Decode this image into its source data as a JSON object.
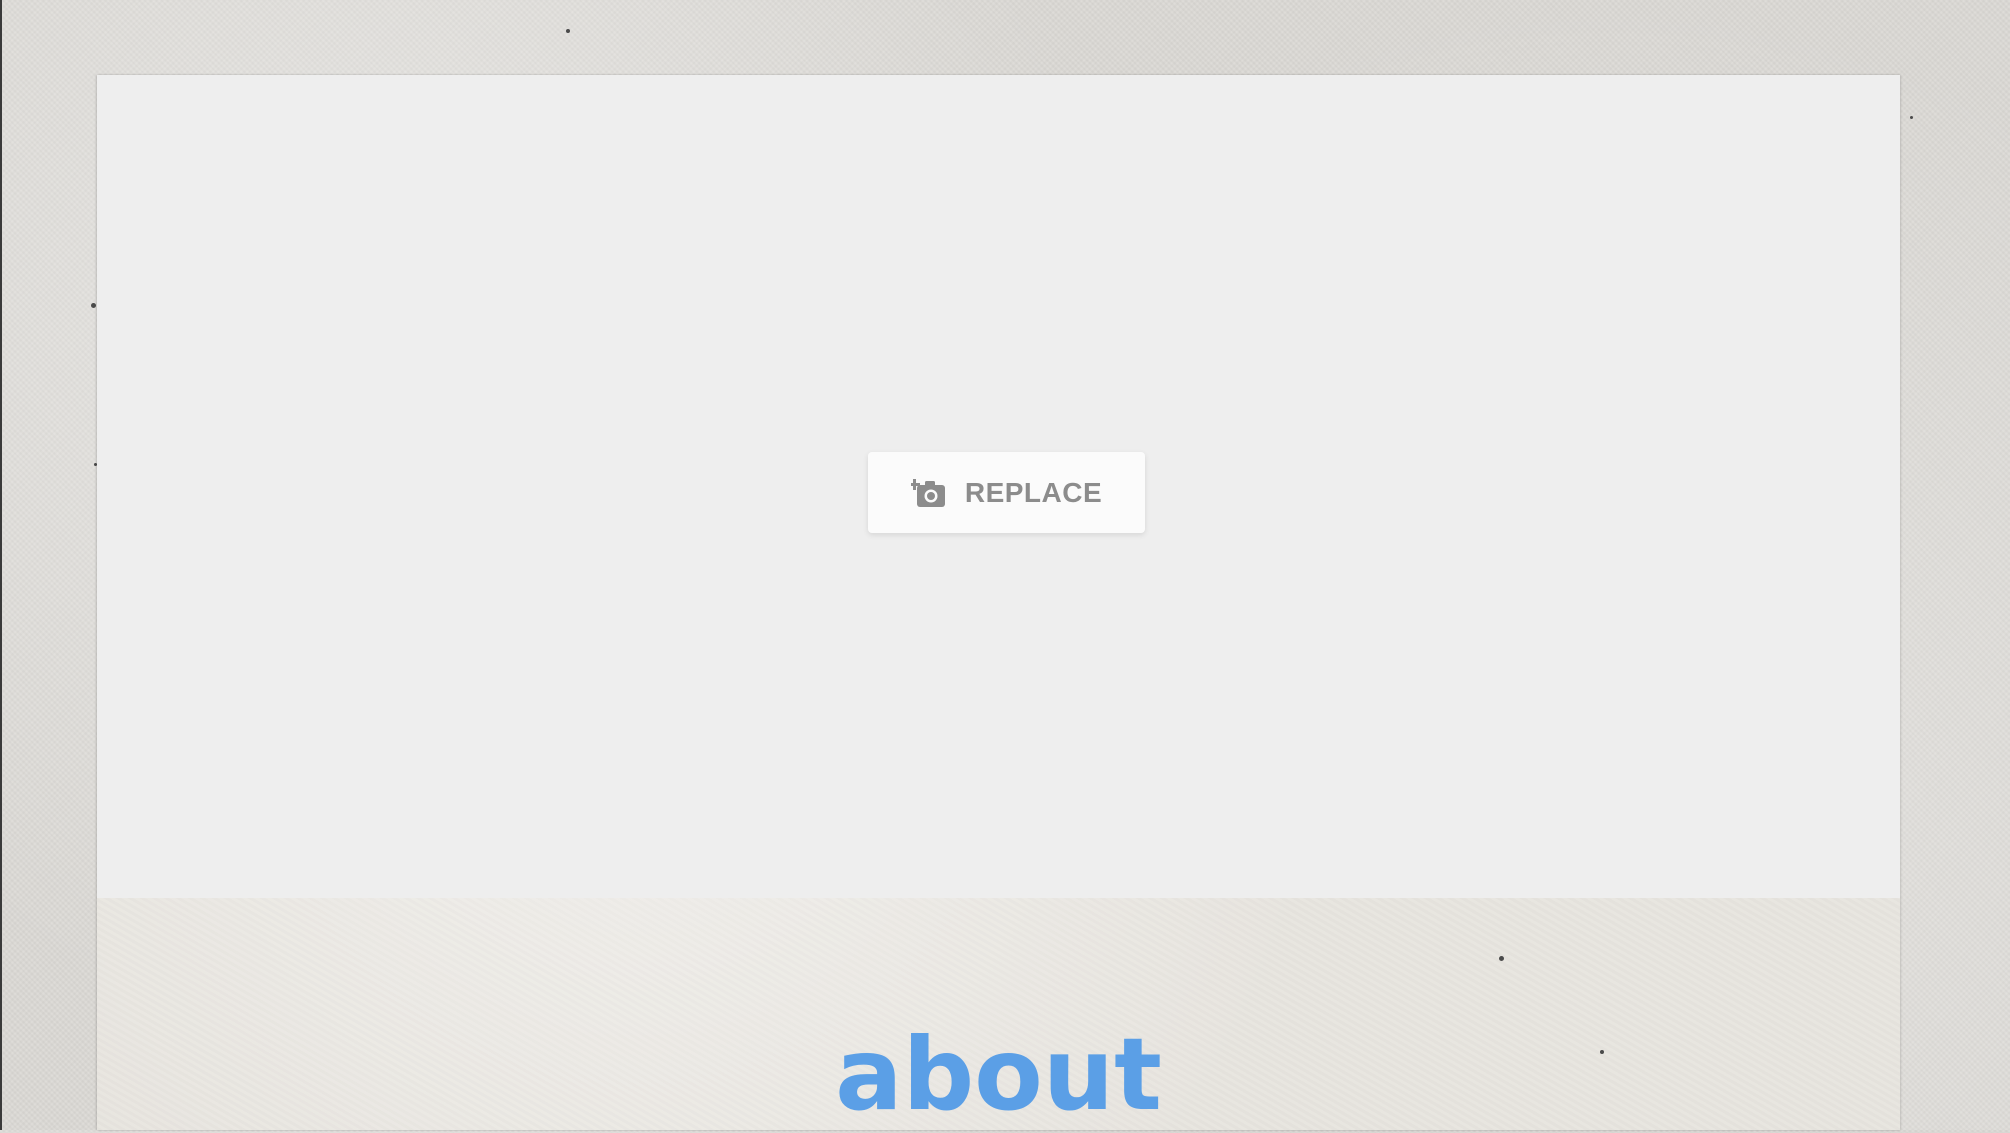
{
  "image_placeholder": {
    "replace_label": "REPLACE",
    "icon": "add-photo-camera-icon"
  },
  "section": {
    "heading": "about",
    "heading_color": "#5b9fe6"
  },
  "colors": {
    "placeholder_bg": "#eeeeee",
    "button_bg": "#fbfbfb",
    "button_text": "#8c8c8c"
  }
}
